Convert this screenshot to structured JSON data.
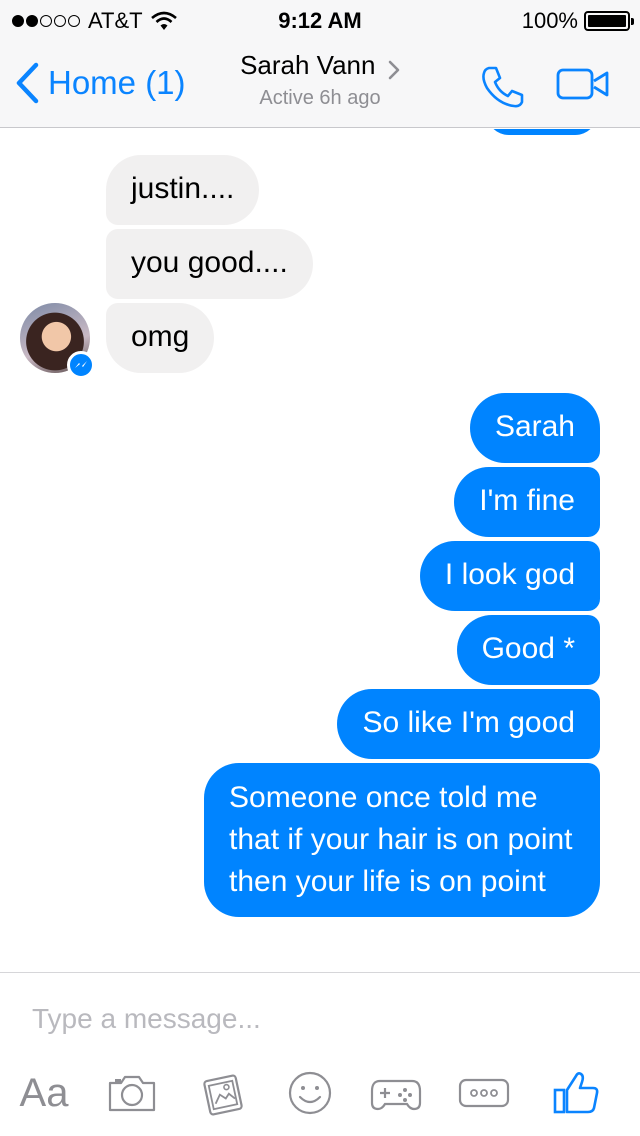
{
  "status_bar": {
    "carrier": "AT&T",
    "time": "9:12 AM",
    "battery_percent": "100%",
    "signal_bars_filled": 2,
    "signal_bars_total": 5
  },
  "nav": {
    "back_label": "Home (1)",
    "contact_name": "Sarah Vann",
    "contact_status": "Active 6h ago",
    "accent_color": "#0A84FF"
  },
  "messages": [
    {
      "sender": "incoming",
      "text": "justin...."
    },
    {
      "sender": "incoming",
      "text": "you good...."
    },
    {
      "sender": "incoming",
      "text": "omg"
    },
    {
      "sender": "outgoing",
      "text": "Sarah"
    },
    {
      "sender": "outgoing",
      "text": "I'm fine"
    },
    {
      "sender": "outgoing",
      "text": "I look god"
    },
    {
      "sender": "outgoing",
      "text": "Good *"
    },
    {
      "sender": "outgoing",
      "text": "So like I'm good"
    },
    {
      "sender": "outgoing",
      "text": "Someone once told me that if your hair is on point then your life is on point"
    }
  ],
  "composer": {
    "placeholder": "Type a message...",
    "text_button_label": "Aa",
    "icons": [
      "camera-icon",
      "gallery-icon",
      "emoji-icon",
      "game-icon",
      "more-icon",
      "thumbs-up-icon"
    ]
  },
  "colors": {
    "outgoing_bubble": "#0084FF",
    "incoming_bubble": "#F1F0F0",
    "icon_gray": "#8E8E93"
  }
}
